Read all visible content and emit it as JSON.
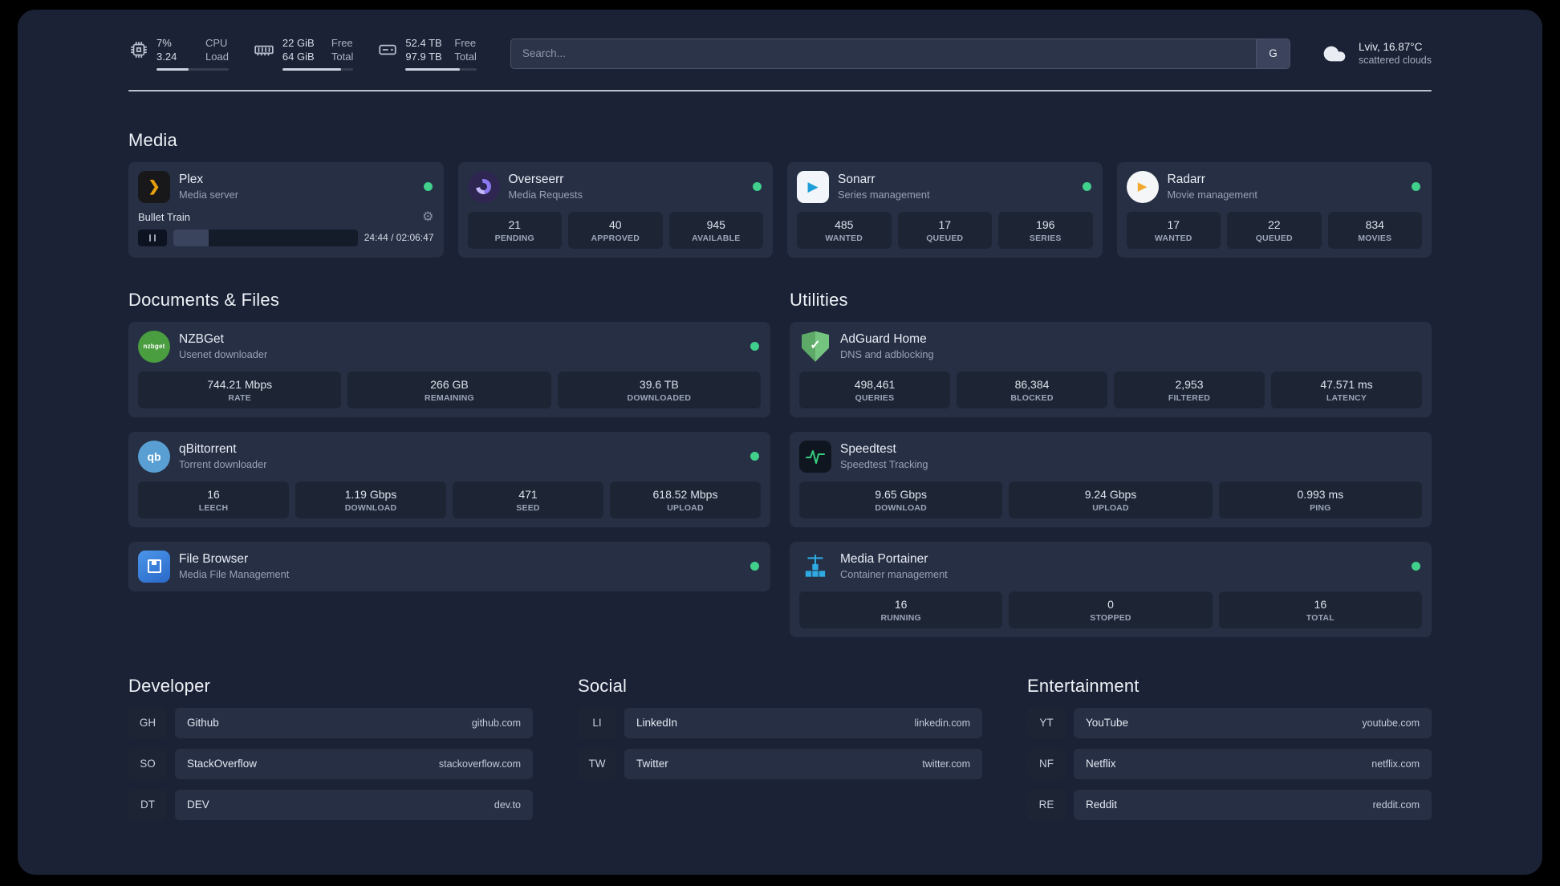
{
  "colors": {
    "status_green": "#41cf8c",
    "plex_amber": "#e5a00d",
    "adguard_green": "#68bc71",
    "portainer_blue": "#2fa9e1"
  },
  "topbar": {
    "resources": [
      {
        "icon": "cpu-icon",
        "value_top": "7%",
        "value_bottom": "3.24",
        "label_top": "CPU",
        "label_bottom": "Load",
        "progress_percent": 45
      },
      {
        "icon": "memory-icon",
        "value_top": "22 GiB",
        "value_bottom": "64 GiB",
        "label_top": "Free",
        "label_bottom": "Total",
        "progress_percent": 83
      },
      {
        "icon": "disk-icon",
        "value_top": "52.4 TB",
        "value_bottom": "97.9 TB",
        "label_top": "Free",
        "label_bottom": "Total",
        "progress_percent": 76
      }
    ],
    "search": {
      "placeholder": "Search...",
      "button_label": "G"
    },
    "weather": {
      "location": "Lviv, 16.87°C",
      "condition": "scattered clouds"
    }
  },
  "groups": {
    "media": {
      "title": "Media",
      "services": [
        {
          "name": "Plex",
          "description": "Media server",
          "icon": "plex-icon",
          "player": {
            "track": "Bullet Train",
            "time": "24:44 / 02:06:47",
            "progress_percent": 19
          }
        },
        {
          "name": "Overseerr",
          "description": "Media Requests",
          "icon": "overseerr-icon",
          "stats": [
            {
              "value": "21",
              "label": "PENDING"
            },
            {
              "value": "40",
              "label": "APPROVED"
            },
            {
              "value": "945",
              "label": "AVAILABLE"
            }
          ]
        },
        {
          "name": "Sonarr",
          "description": "Series management",
          "icon": "sonarr-icon",
          "stats": [
            {
              "value": "485",
              "label": "WANTED"
            },
            {
              "value": "17",
              "label": "QUEUED"
            },
            {
              "value": "196",
              "label": "SERIES"
            }
          ]
        },
        {
          "name": "Radarr",
          "description": "Movie management",
          "icon": "radarr-icon",
          "stats": [
            {
              "value": "17",
              "label": "WANTED"
            },
            {
              "value": "22",
              "label": "QUEUED"
            },
            {
              "value": "834",
              "label": "MOVIES"
            }
          ]
        }
      ]
    },
    "documents": {
      "title": "Documents & Files",
      "services": [
        {
          "name": "NZBGet",
          "description": "Usenet downloader",
          "icon": "nzbget-icon",
          "icon_label": "nzbget",
          "stats": [
            {
              "value": "744.21 Mbps",
              "label": "RATE"
            },
            {
              "value": "266 GB",
              "label": "REMAINING"
            },
            {
              "value": "39.6 TB",
              "label": "DOWNLOADED"
            }
          ]
        },
        {
          "name": "qBittorrent",
          "description": "Torrent downloader",
          "icon": "qbittorrent-icon",
          "icon_label": "qb",
          "stats": [
            {
              "value": "16",
              "label": "LEECH"
            },
            {
              "value": "1.19 Gbps",
              "label": "DOWNLOAD"
            },
            {
              "value": "471",
              "label": "SEED"
            },
            {
              "value": "618.52 Mbps",
              "label": "UPLOAD"
            }
          ]
        },
        {
          "name": "File Browser",
          "description": "Media File Management",
          "icon": "filebrowser-icon"
        }
      ]
    },
    "utilities": {
      "title": "Utilities",
      "services": [
        {
          "name": "AdGuard Home",
          "description": "DNS and adblocking",
          "icon": "adguard-icon",
          "stats": [
            {
              "value": "498,461",
              "label": "QUERIES"
            },
            {
              "value": "86,384",
              "label": "BLOCKED"
            },
            {
              "value": "2,953",
              "label": "FILTERED"
            },
            {
              "value": "47.571 ms",
              "label": "LATENCY"
            }
          ]
        },
        {
          "name": "Speedtest",
          "description": "Speedtest Tracking",
          "icon": "speedtest-icon",
          "stats": [
            {
              "value": "9.65 Gbps",
              "label": "DOWNLOAD"
            },
            {
              "value": "9.24 Gbps",
              "label": "UPLOAD"
            },
            {
              "value": "0.993 ms",
              "label": "PING"
            }
          ]
        },
        {
          "name": "Media Portainer",
          "description": "Container management",
          "icon": "portainer-icon",
          "stats": [
            {
              "value": "16",
              "label": "RUNNING"
            },
            {
              "value": "0",
              "label": "STOPPED"
            },
            {
              "value": "16",
              "label": "TOTAL"
            }
          ]
        }
      ]
    }
  },
  "bookmarks": [
    {
      "title": "Developer",
      "items": [
        {
          "abbr": "GH",
          "name": "Github",
          "url": "github.com"
        },
        {
          "abbr": "SO",
          "name": "StackOverflow",
          "url": "stackoverflow.com"
        },
        {
          "abbr": "DT",
          "name": "DEV",
          "url": "dev.to"
        }
      ]
    },
    {
      "title": "Social",
      "items": [
        {
          "abbr": "LI",
          "name": "LinkedIn",
          "url": "linkedin.com"
        },
        {
          "abbr": "TW",
          "name": "Twitter",
          "url": "twitter.com"
        }
      ]
    },
    {
      "title": "Entertainment",
      "items": [
        {
          "abbr": "YT",
          "name": "YouTube",
          "url": "youtube.com"
        },
        {
          "abbr": "NF",
          "name": "Netflix",
          "url": "netflix.com"
        },
        {
          "abbr": "RE",
          "name": "Reddit",
          "url": "reddit.com"
        }
      ]
    }
  ]
}
